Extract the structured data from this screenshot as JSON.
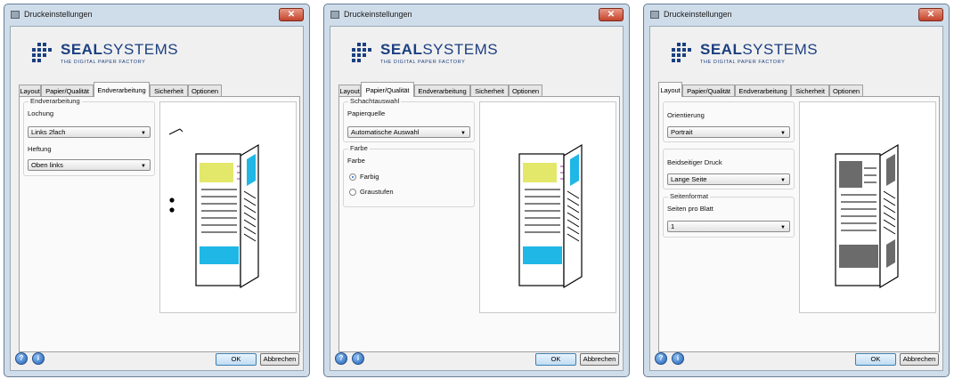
{
  "window_title": "Druckeinstellungen",
  "close_glyph": "✕",
  "logo": {
    "brand_bold": "SEAL",
    "brand_rest": "SYSTEMS",
    "tagline": "THE DIGITAL PAPER FACTORY"
  },
  "tabs": [
    "Layout",
    "Papier/Qualität",
    "Endverarbeitung",
    "Sicherheit",
    "Optionen"
  ],
  "footer": {
    "help_glyph": "?",
    "info_glyph": "i",
    "ok_label": "OK",
    "cancel_label": "Abbrechen"
  },
  "dialogs": [
    {
      "active_tab": "Endverarbeitung",
      "group_title": "Endverarbeitung",
      "lochung_label": "Lochung",
      "lochung_value": "Links 2fach",
      "heftung_label": "Heftung",
      "heftung_value": "Oben links"
    },
    {
      "active_tab": "Papier/Qualität",
      "schacht_title": "Schachtauswahl",
      "papierquelle_label": "Papierquelle",
      "papierquelle_value": "Automatische Auswahl",
      "farbe_title": "Farbe",
      "farbe_label": "Farbe",
      "radio_farbig": "Farbig",
      "radio_graustufen": "Graustufen",
      "selected_color_mode": "Farbig"
    },
    {
      "active_tab": "Layout",
      "orientierung_label": "Orientierung",
      "orientierung_value": "Portrait",
      "duplex_label": "Beidseitiger Druck",
      "duplex_value": "Lange Seite",
      "seitenformat_title": "Seitenformat",
      "seiten_label": "Seiten pro Blatt",
      "seiten_value": "1"
    }
  ],
  "colors": {
    "accent_cyan": "#1fb7e6",
    "accent_yellow": "#e4e86a",
    "accent_magenta": "#9e3c9a",
    "brand_blue": "#1b3f80"
  }
}
